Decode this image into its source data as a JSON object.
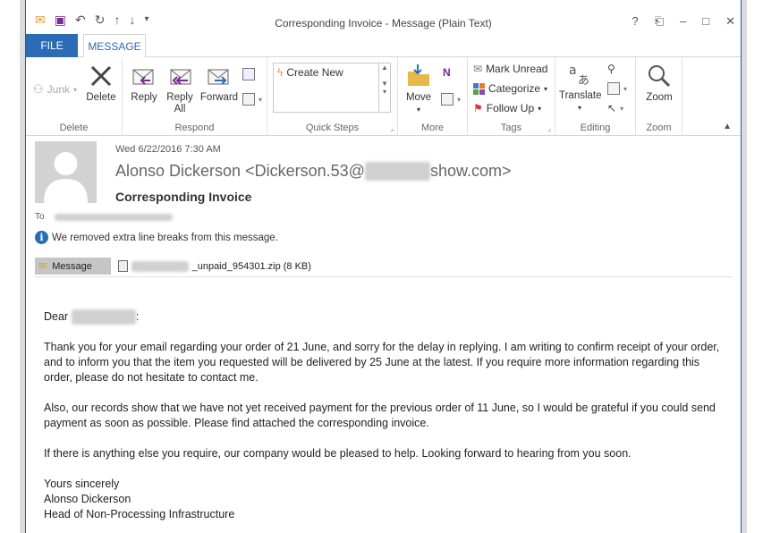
{
  "window": {
    "title": "Corresponding Invoice - Message (Plain Text)",
    "controls": [
      "?",
      "⎗",
      "–",
      "□",
      "✕"
    ]
  },
  "tabs": {
    "file": "FILE",
    "message": "MESSAGE"
  },
  "ribbon": {
    "delete_group": {
      "label": "Delete",
      "junk": "Junk",
      "delete": "Delete"
    },
    "respond_group": {
      "label": "Respond",
      "reply": "Reply",
      "reply_all_1": "Reply",
      "reply_all_2": "All",
      "forward": "Forward"
    },
    "quick_steps": {
      "label": "Quick Steps",
      "create_new": "Create New"
    },
    "move_group": {
      "label": "More",
      "move": "Move"
    },
    "tags_group": {
      "label": "Tags",
      "mark_unread": "Mark Unread",
      "categorize": "Categorize",
      "follow_up": "Follow Up"
    },
    "editing_group": {
      "label": "Editing",
      "translate": "Translate"
    },
    "zoom_group": {
      "label": "Zoom",
      "zoom": "Zoom"
    }
  },
  "header": {
    "date": "Wed 6/22/2016 7:30 AM",
    "sender_name": "Alonso Dickerson <Dickerson.53@",
    "sender_domain_end": "show.com>",
    "subject": "Corresponding Invoice",
    "to_label": "To",
    "info": "We removed extra line breaks from this message."
  },
  "attachments": {
    "message_label": "Message",
    "file_name": "_unpaid_954301.zip (8 KB)"
  },
  "body": {
    "greeting_start": "Dear",
    "greeting_end": ":",
    "p1": "Thank you for your email regarding your order of 21 June, and sorry for the delay in replying. I am writing to confirm receipt of your order, and to inform you that the item you requested will be delivered by 25 June at the latest. If you require more information regarding this order, please do not hesitate to contact me.",
    "p2": "Also, our records show that we have not yet received payment for the previous order of 11 June, so I would be grateful if you could send payment as soon as possible. Please find attached the corresponding invoice.",
    "p3": "If there is anything else you require, our company would be pleased to help. Looking forward to hearing from you soon.",
    "closing": "Yours sincerely",
    "sig_name": "Alonso Dickerson",
    "sig_title": "Head of Non-Processing Infrastructure"
  },
  "colors": {
    "accent": "#2b6cb5",
    "file_tab": "#2b6cb5",
    "border": "#2b579a"
  }
}
